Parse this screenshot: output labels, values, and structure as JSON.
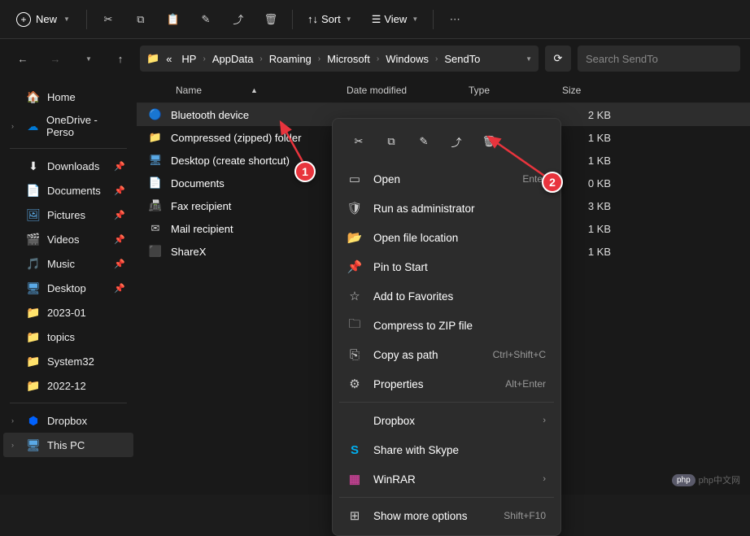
{
  "toolbar": {
    "new_label": "New",
    "sort_label": "Sort",
    "view_label": "View"
  },
  "breadcrumb": {
    "prefix": "«",
    "items": [
      "HP",
      "AppData",
      "Roaming",
      "Microsoft",
      "Windows",
      "SendTo"
    ]
  },
  "search_placeholder": "Search SendTo",
  "columns": {
    "name": "Name",
    "date": "Date modified",
    "type": "Type",
    "size": "Size"
  },
  "sidebar": {
    "home": "Home",
    "onedrive": "OneDrive - Perso",
    "quick": [
      {
        "icon": "⬇",
        "label": "Downloads",
        "pinned": true
      },
      {
        "icon": "📄",
        "label": "Documents",
        "pinned": true,
        "color": "#5aa9e6"
      },
      {
        "icon": "🖼",
        "label": "Pictures",
        "pinned": true,
        "color": "#5aa9e6"
      },
      {
        "icon": "🎬",
        "label": "Videos",
        "pinned": true,
        "color": "#5aa9e6"
      },
      {
        "icon": "🎵",
        "label": "Music",
        "pinned": true
      },
      {
        "icon": "🖥",
        "label": "Desktop",
        "pinned": true,
        "color": "#5aa9e6"
      },
      {
        "icon": "📁",
        "label": "2023-01",
        "pinned": false
      },
      {
        "icon": "📁",
        "label": "topics",
        "pinned": false
      },
      {
        "icon": "📁",
        "label": "System32",
        "pinned": false
      },
      {
        "icon": "📁",
        "label": "2022-12",
        "pinned": false
      }
    ],
    "dropbox": "Dropbox",
    "thispc": "This PC"
  },
  "files": [
    {
      "icon": "bt",
      "name": "Bluetooth device",
      "size": "2 KB"
    },
    {
      "icon": "zip",
      "name": "Compressed (zipped) folder",
      "size": "1 KB"
    },
    {
      "icon": "desk",
      "name": "Desktop (create shortcut)",
      "size": "1 KB"
    },
    {
      "icon": "doc",
      "name": "Documents",
      "size": "0 KB"
    },
    {
      "icon": "fax",
      "name": "Fax recipient",
      "size": "3 KB"
    },
    {
      "icon": "mail",
      "name": "Mail recipient",
      "size": "1 KB"
    },
    {
      "icon": "sharex",
      "name": "ShareX",
      "size": "1 KB"
    }
  ],
  "context_menu": {
    "items": [
      {
        "icon": "▭",
        "label": "Open",
        "accel": "Enter"
      },
      {
        "icon": "🛡",
        "label": "Run as administrator"
      },
      {
        "icon": "📂",
        "label": "Open file location"
      },
      {
        "icon": "📌",
        "label": "Pin to Start"
      },
      {
        "icon": "☆",
        "label": "Add to Favorites"
      },
      {
        "icon": "🗀",
        "label": "Compress to ZIP file"
      },
      {
        "icon": "⎘",
        "label": "Copy as path",
        "accel": "Ctrl+Shift+C"
      },
      {
        "icon": "⚙",
        "label": "Properties",
        "accel": "Alt+Enter"
      }
    ],
    "apps": [
      {
        "icon": "",
        "label": "Dropbox",
        "arrow": true
      },
      {
        "icon": "S",
        "label": "Share with Skype",
        "color": "#00aff0"
      },
      {
        "icon": "▦",
        "label": "WinRAR",
        "arrow": true,
        "color": "#c04090"
      }
    ],
    "more": {
      "label": "Show more options",
      "accel": "Shift+F10"
    }
  },
  "annotations": {
    "one": "1",
    "two": "2"
  },
  "watermark": "php中文网"
}
